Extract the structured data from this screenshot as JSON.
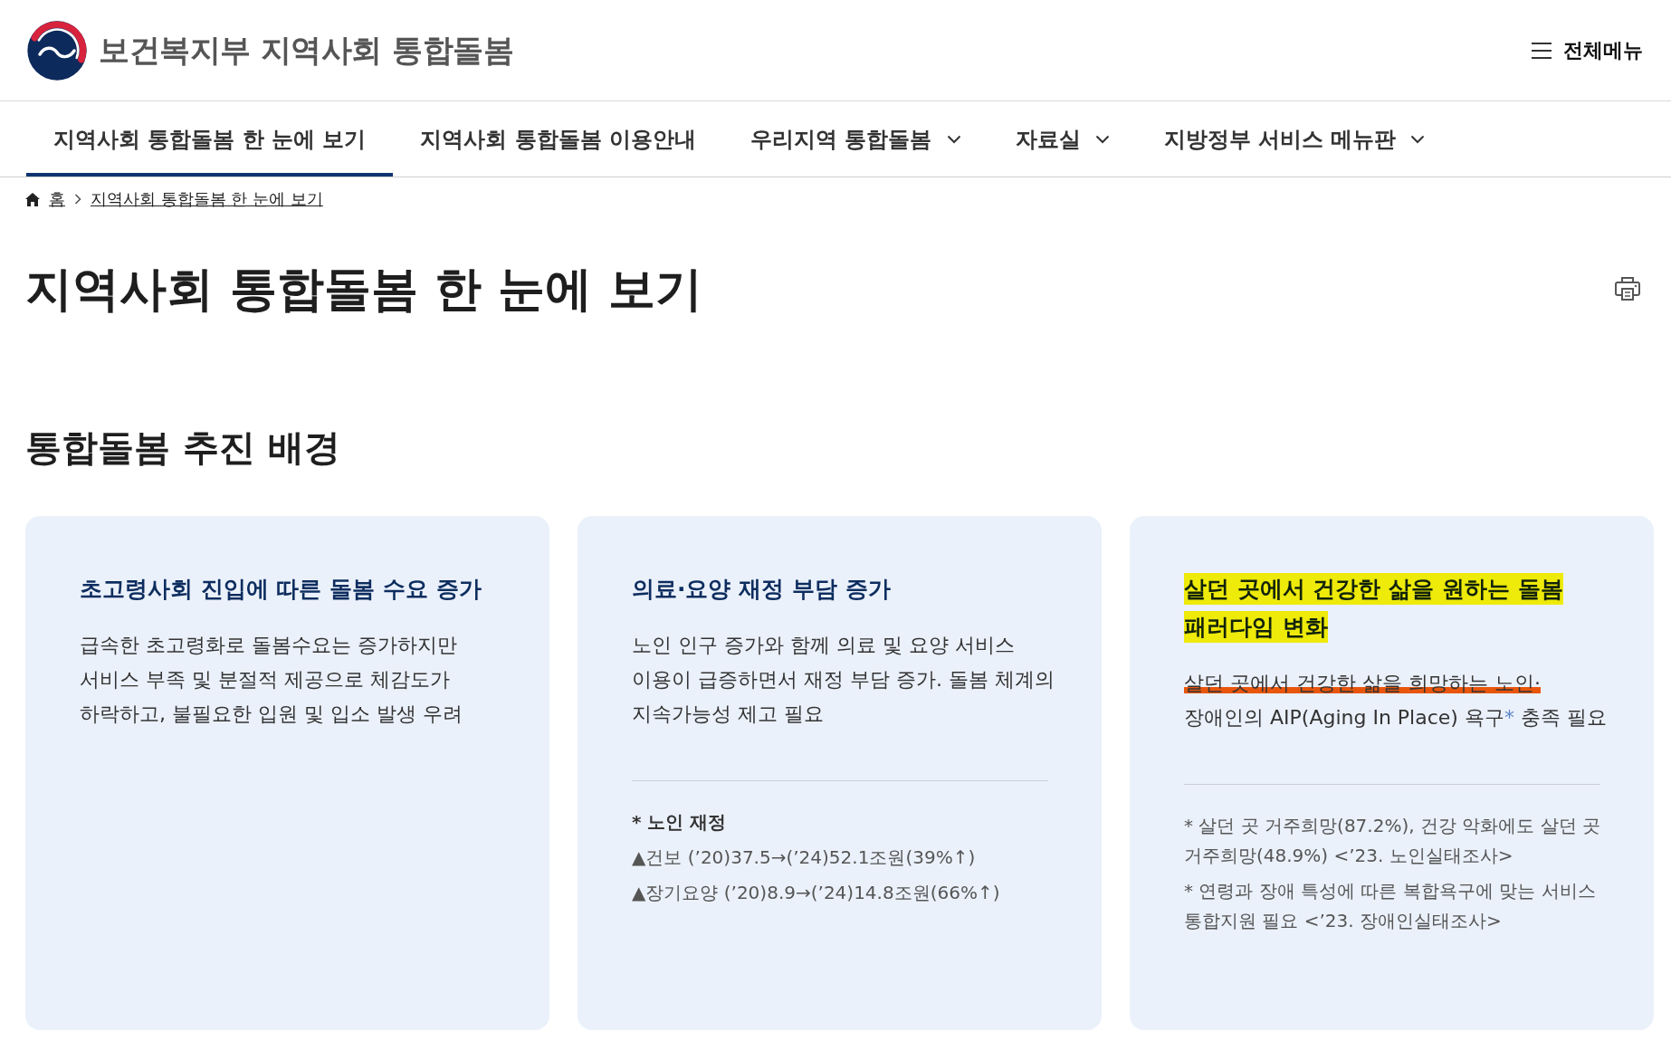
{
  "header": {
    "logo_text": "보건복지부 지역사회 통합돌봄",
    "menu_button": "전체메뉴"
  },
  "nav": {
    "items": [
      {
        "label": "지역사회 통합돌봄 한 눈에 보기",
        "kind": "link",
        "selected": true
      },
      {
        "label": "지역사회 통합돌봄 이용안내",
        "kind": "link",
        "selected": false
      },
      {
        "label": "우리지역 통합돌봄",
        "kind": "dropdown",
        "selected": false
      },
      {
        "label": "자료실",
        "kind": "dropdown",
        "selected": false
      },
      {
        "label": "지방정부 서비스 메뉴판",
        "kind": "dropdown",
        "selected": false
      }
    ]
  },
  "breadcrumb": [
    "홈",
    "지역사회 통합돌봄 한 눈에 보기"
  ],
  "page_title": "지역사회 통합돌봄 한 눈에 보기",
  "section": {
    "title": "통합돌봄 추진 배경",
    "cards": [
      {
        "title": "초고령사회 진입에 따른 돌봄 수요 증가",
        "highlighted": false,
        "body": [
          {
            "kind": "text",
            "text": "급속한 초고령화로 돌봄수요는 증가하지만 서비스 부족 및 분절적 제공으로 체감도가 하락하고, 불필요한 입원 및 입소 발생 우려"
          }
        ]
      },
      {
        "title": "의료·요양 재정 부담 증가",
        "highlighted": false,
        "body": [
          {
            "kind": "text",
            "text": "노인 인구 증가와 함께 의료 및 요양 서비스 이용이 급증하면서 재정 부담 증가. 돌봄 체계의 지속가능성 제고 필요"
          }
        ],
        "notes": [
          {
            "kind": "heading",
            "text": "* 노인 재정"
          },
          {
            "kind": "note",
            "text": "▲건보 (’20)37.5→(’24)52.1조원(39%↑)"
          },
          {
            "kind": "note",
            "text": "▲장기요양 (’20)8.9→(’24)14.8조원(66%↑)"
          }
        ]
      },
      {
        "title": "살던 곳에서 건강한 삶을 원하는 돌봄 패러다임 변화",
        "highlighted": true,
        "body": [
          {
            "kind": "underlined",
            "text": "살던 곳에서 건강한 삶을 희망하는 노인·"
          },
          {
            "kind": "text",
            "text": "장애인의 AIP(Aging In Place) 욕구"
          },
          {
            "kind": "footnote-mark",
            "text": "*"
          },
          {
            "kind": "text",
            "text": " 충족 필요"
          }
        ],
        "notes": [
          {
            "kind": "note",
            "text": "* 살던 곳 거주희망(87.2%), 건강 악화에도 살던 곳 거주희망(48.9%) <’23. 노인실태조사>"
          },
          {
            "kind": "note",
            "text": "* 연령과 장애 특성에 따른 복합욕구에 맞는 서비스 통합지원 필요 <’23. 장애인실태조사>"
          }
        ]
      }
    ]
  }
}
